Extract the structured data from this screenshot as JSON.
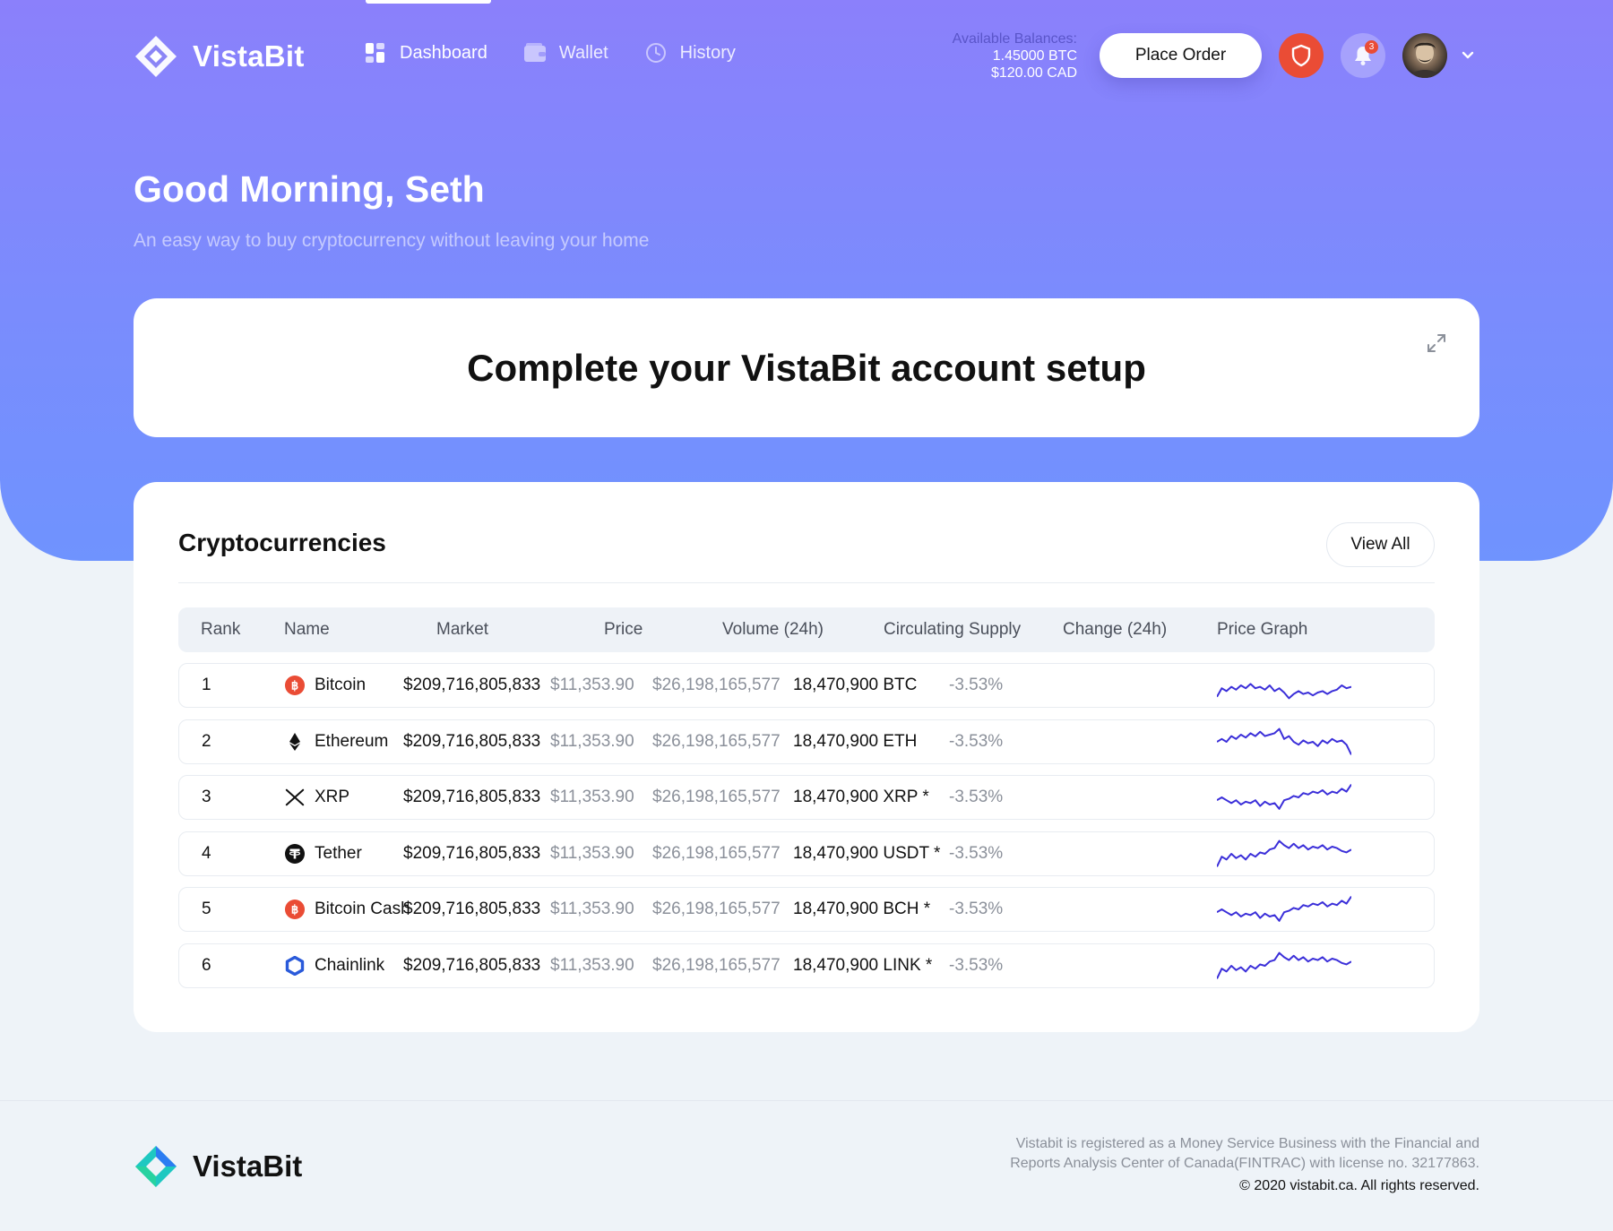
{
  "brand": {
    "name": "VistaBit"
  },
  "nav": {
    "items": [
      {
        "label": "Dashboard",
        "icon": "dashboard-icon",
        "active": true
      },
      {
        "label": "Wallet",
        "icon": "wallet-icon",
        "active": false
      },
      {
        "label": "History",
        "icon": "history-icon",
        "active": false
      }
    ]
  },
  "balances": {
    "label": "Available Balances:",
    "btc": "1.45000 BTC",
    "cad": "$120.00 CAD"
  },
  "header": {
    "place_order_label": "Place Order",
    "notification_count": "3"
  },
  "hero": {
    "greeting": "Good Morning, Seth",
    "subtitle": "An easy way to buy cryptocurrency without leaving your home"
  },
  "setup": {
    "title": "Complete your VistaBit account setup"
  },
  "crypto": {
    "title": "Cryptocurrencies",
    "view_all_label": "View All",
    "columns": [
      "Rank",
      "Name",
      "Market",
      "Price",
      "Volume (24h)",
      "Circulating Supply",
      "Change (24h)",
      "Price Graph"
    ],
    "rows": [
      {
        "rank": "1",
        "name": "Bitcoin",
        "icon": "bitcoin-icon",
        "market": "$209,716,805,833",
        "price": "$11,353.90",
        "volume": "$26,198,165,577",
        "supply": "18,470,900 BTC",
        "change": "-3.53%",
        "spark": [
          0.9,
          0.6,
          0.7,
          0.55,
          0.65,
          0.5,
          0.6,
          0.45,
          0.6,
          0.55,
          0.65,
          0.5,
          0.7,
          0.6,
          0.75,
          0.95,
          0.8,
          0.7,
          0.8,
          0.75,
          0.85,
          0.75,
          0.7,
          0.8,
          0.7,
          0.65,
          0.5,
          0.6,
          0.55
        ]
      },
      {
        "rank": "2",
        "name": "Ethereum",
        "icon": "ethereum-icon",
        "market": "$209,716,805,833",
        "price": "$11,353.90",
        "volume": "$26,198,165,577",
        "supply": "18,470,900 ETH",
        "change": "-3.53%",
        "spark": [
          0.5,
          0.4,
          0.5,
          0.3,
          0.4,
          0.25,
          0.35,
          0.2,
          0.3,
          0.15,
          0.3,
          0.25,
          0.2,
          0.05,
          0.4,
          0.3,
          0.5,
          0.6,
          0.45,
          0.55,
          0.5,
          0.65,
          0.45,
          0.55,
          0.4,
          0.5,
          0.45,
          0.6,
          0.95
        ]
      },
      {
        "rank": "3",
        "name": "XRP",
        "icon": "xrp-icon",
        "market": "$209,716,805,833",
        "price": "$11,353.90",
        "volume": "$26,198,165,577",
        "supply": "18,470,900 XRP *",
        "change": "-3.53%",
        "spark": [
          0.6,
          0.5,
          0.6,
          0.7,
          0.6,
          0.75,
          0.65,
          0.7,
          0.6,
          0.8,
          0.65,
          0.75,
          0.7,
          0.9,
          0.6,
          0.55,
          0.45,
          0.5,
          0.35,
          0.4,
          0.3,
          0.35,
          0.25,
          0.4,
          0.3,
          0.35,
          0.2,
          0.3,
          0.05
        ]
      },
      {
        "rank": "4",
        "name": "Tether",
        "icon": "tether-icon",
        "market": "$209,716,805,833",
        "price": "$11,353.90",
        "volume": "$26,198,165,577",
        "supply": "18,470,900 USDT *",
        "change": "-3.53%",
        "spark": [
          0.95,
          0.6,
          0.7,
          0.5,
          0.65,
          0.55,
          0.7,
          0.5,
          0.6,
          0.45,
          0.5,
          0.35,
          0.3,
          0.05,
          0.2,
          0.3,
          0.15,
          0.3,
          0.2,
          0.35,
          0.25,
          0.3,
          0.2,
          0.35,
          0.25,
          0.3,
          0.4,
          0.45,
          0.35
        ]
      },
      {
        "rank": "5",
        "name": "Bitcoin Cash",
        "icon": "bitcoin-cash-icon",
        "market": "$209,716,805,833",
        "price": "$11,353.90",
        "volume": "$26,198,165,577",
        "supply": "18,470,900 BCH *",
        "change": "-3.53%",
        "spark": [
          0.6,
          0.5,
          0.6,
          0.7,
          0.6,
          0.75,
          0.65,
          0.7,
          0.6,
          0.8,
          0.65,
          0.75,
          0.7,
          0.9,
          0.6,
          0.55,
          0.45,
          0.5,
          0.35,
          0.4,
          0.3,
          0.35,
          0.25,
          0.4,
          0.3,
          0.35,
          0.2,
          0.3,
          0.05
        ]
      },
      {
        "rank": "6",
        "name": "Chainlink",
        "icon": "chainlink-icon",
        "market": "$209,716,805,833",
        "price": "$11,353.90",
        "volume": "$26,198,165,577",
        "supply": "18,470,900 LINK *",
        "change": "-3.53%",
        "spark": [
          0.95,
          0.6,
          0.7,
          0.5,
          0.65,
          0.55,
          0.7,
          0.5,
          0.6,
          0.45,
          0.5,
          0.35,
          0.3,
          0.05,
          0.2,
          0.3,
          0.15,
          0.3,
          0.2,
          0.35,
          0.25,
          0.3,
          0.2,
          0.35,
          0.25,
          0.3,
          0.4,
          0.45,
          0.35
        ]
      }
    ]
  },
  "footer": {
    "brand": "VistaBit",
    "legal_line1": "Vistabit is registered as a Money Service Business with the Financial and",
    "legal_line2": "Reports Analysis Center of Canada(FINTRAC) with license no. 32177863.",
    "copyright": "© 2020 vistabit.ca. All rights reserved."
  },
  "colors": {
    "accent": "#7a8cfd",
    "spark": "#3b2fd9",
    "danger": "#ea4c35"
  }
}
